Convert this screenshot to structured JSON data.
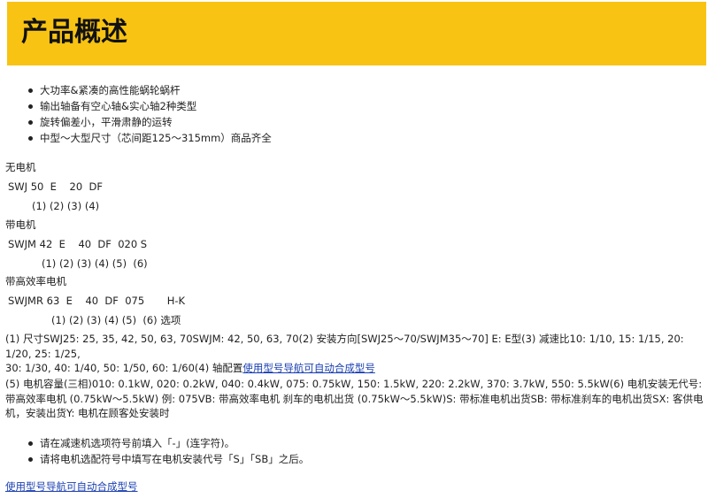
{
  "header": {
    "title": "产品概述",
    "accent_color": "#f8c312"
  },
  "features": [
    "大功率&紧凑的高性能蜗轮蜗杆",
    "输出轴备有空心轴&实心轴2种类型",
    "旋转偏差小，平滑肃静的运转",
    "中型～大型尺寸（芯间距125～315mm）商品齐全"
  ],
  "no_motor": {
    "title": "无电机",
    "code": "SWJ 50  E    20  DF",
    "indices": "(1) (2) (3) (4)"
  },
  "with_motor": {
    "title": "带电机",
    "code": "SWJM 42  E    40  DF  020 S",
    "indices": "(1) (2) (3) (4) (5)  (6)"
  },
  "hi_eff_motor": {
    "title": "带高效率电机",
    "code": "SWJMR 63  E    40  DF  075       H-K",
    "indices": "(1) (2) (3) (4) (5)  (6) 选项"
  },
  "spec": {
    "text1": "(1) 尺寸SWJ25: 25, 35, 42, 50, 63, 70SWJM: 42, 50, 63, 70(2) 安装方向[SWJ25～70/SWJM35～70] E: E型(3) 减速比10: 1/10, 15: 1/15, 20: 1/20, 25: 1/25,",
    "text2": "30: 1/30, 40: 1/40, 50: 1/50, 60: 1/60(4) 轴配置",
    "link": "使用型号导航可自动合成型号",
    "text3": "(5) 电机容量(三相)010: 0.1kW, 020: 0.2kW, 040: 0.4kW, 075: 0.75kW, 150: 1.5kW, 220: 2.2kW, 370: 3.7kW, 550: 5.5kW(6) 电机安装无代号: 带高效率电机 (0.75kW～5.5kW) 例: 075VB: 带高效率电机 刹车的电机出货 (0.75kW～5.5kW)S: 带标准电机出货SB: 带标准刹车的电机出货SX: 客供电机，安装出货Y: 电机在顾客处安装时"
  },
  "notes": [
    "请在减速机选项符号前填入「-」(连字符)。",
    "请将电机选配符号中填写在电机安装代号「S」「SB」之后。"
  ],
  "footer_link": "使用型号导航可自动合成型号"
}
